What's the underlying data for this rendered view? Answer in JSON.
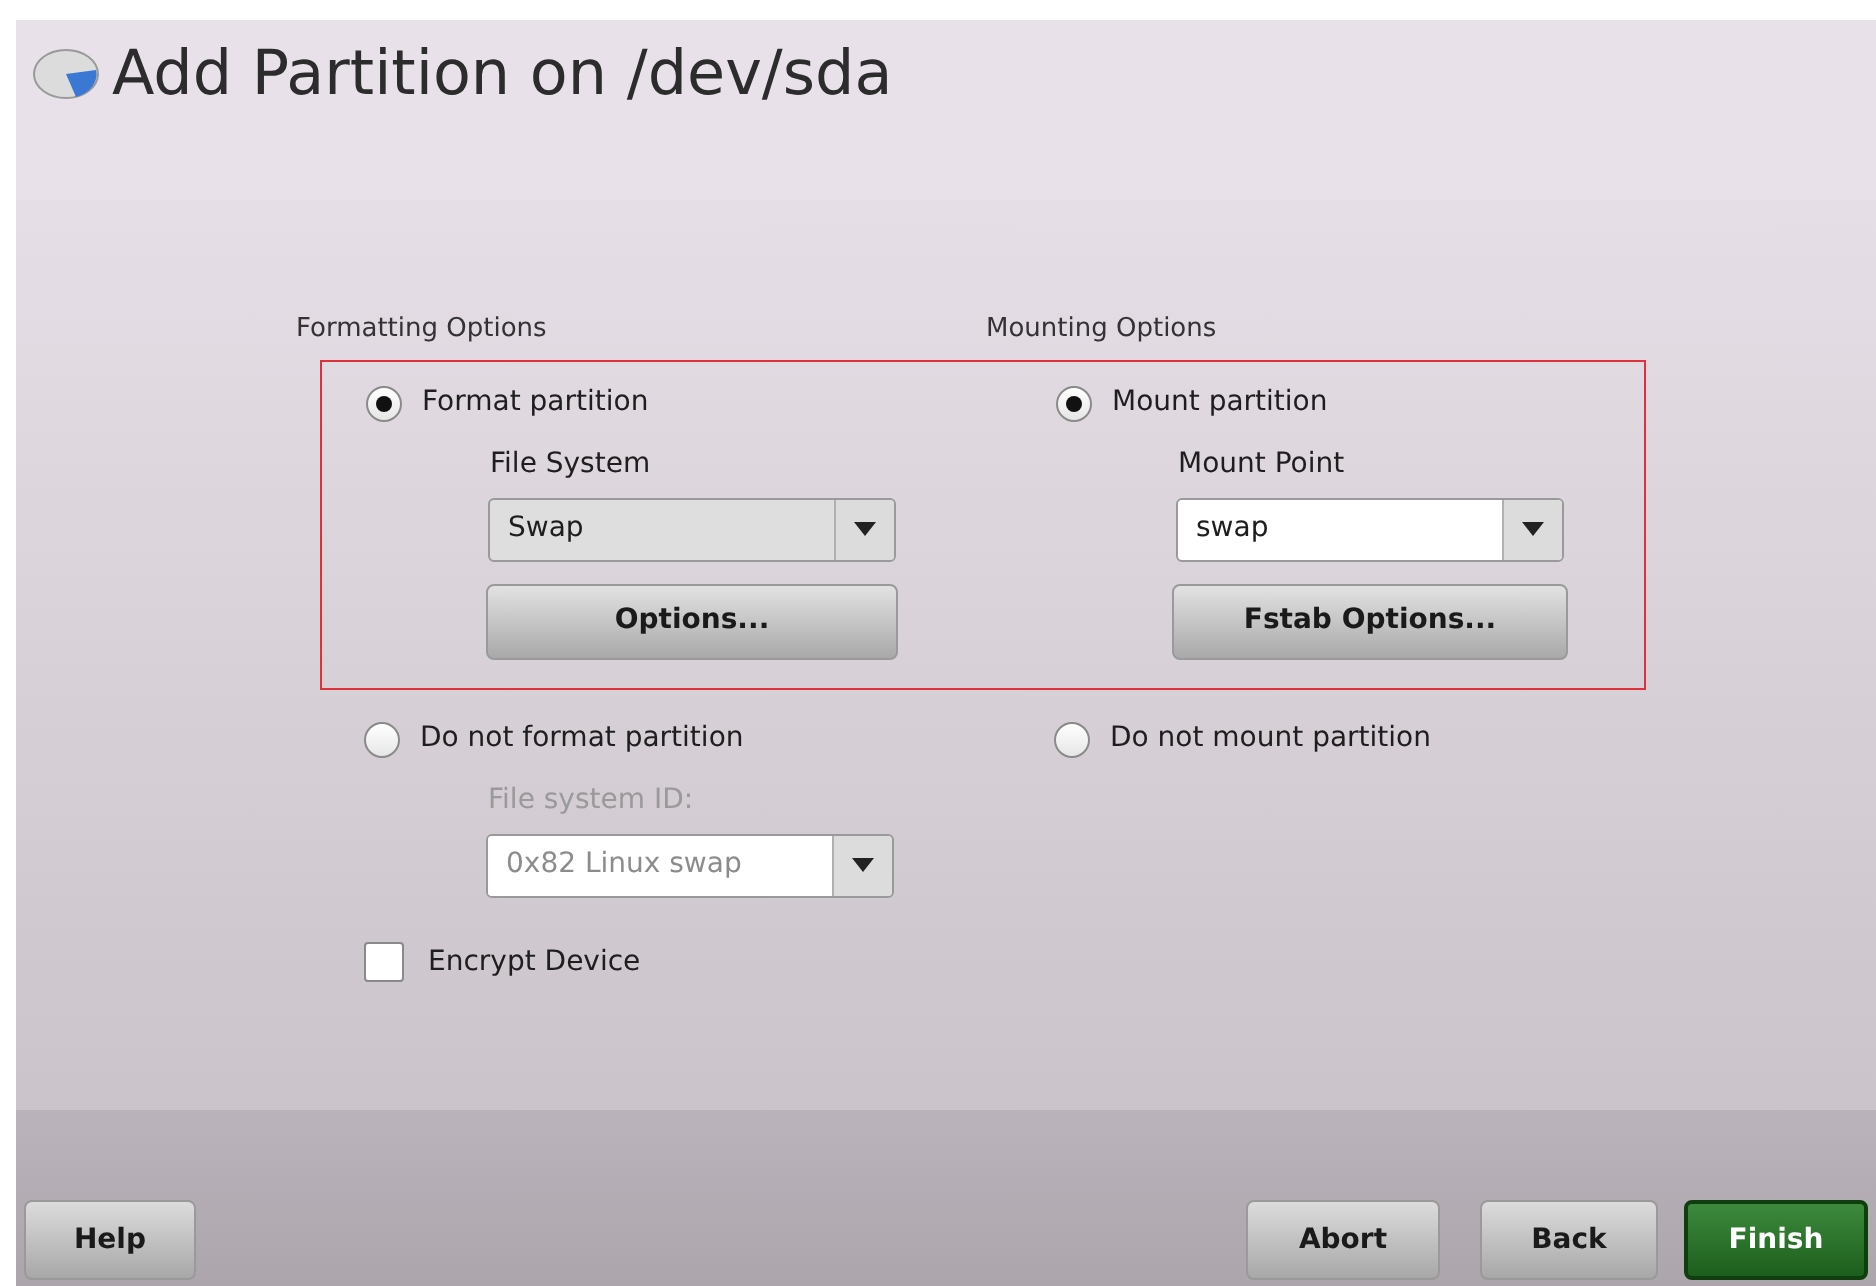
{
  "title": "Add Partition on /dev/sda",
  "formatting": {
    "heading": "Formatting Options",
    "options": [
      {
        "label": "Format partition",
        "selected": true
      },
      {
        "label": "Do not format partition",
        "selected": false
      }
    ],
    "file_system": {
      "label": "File System",
      "value": "Swap"
    },
    "options_button": "Options...",
    "file_system_id": {
      "label": "File system ID:",
      "value": "0x82 Linux swap",
      "disabled": true
    }
  },
  "mounting": {
    "heading": "Mounting Options",
    "options": [
      {
        "label": "Mount partition",
        "selected": true
      },
      {
        "label": "Do not mount partition",
        "selected": false
      }
    ],
    "mount_point": {
      "label": "Mount Point",
      "value": "swap"
    },
    "fstab_button": "Fstab Options..."
  },
  "encrypt_device": {
    "label": "Encrypt Device",
    "checked": false
  },
  "buttons": [
    {
      "label": "Help",
      "kind": "normal"
    },
    {
      "label": "Abort",
      "kind": "normal"
    },
    {
      "label": "Back",
      "kind": "normal"
    },
    {
      "label": "Finish",
      "kind": "default"
    }
  ]
}
